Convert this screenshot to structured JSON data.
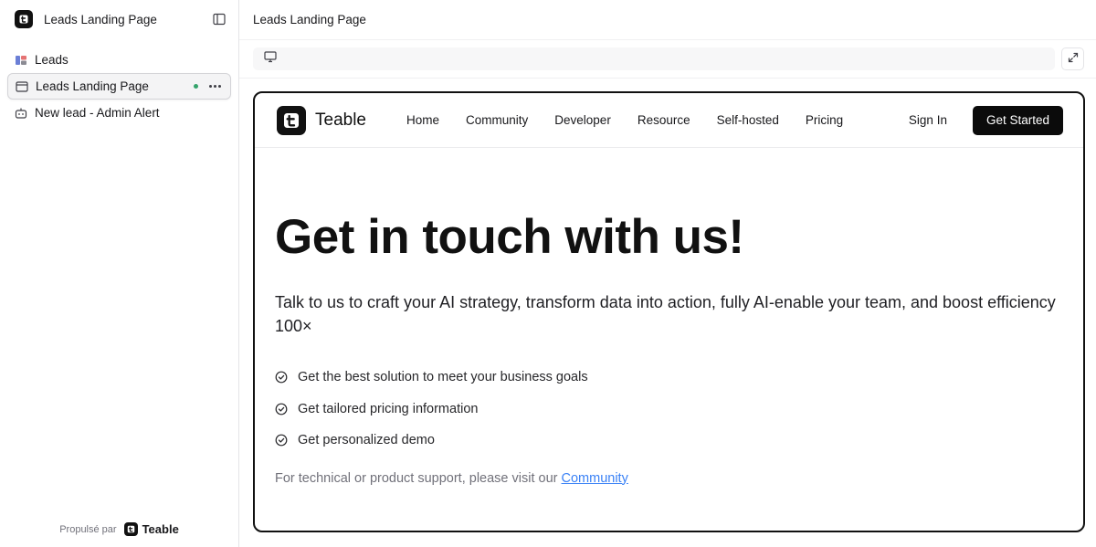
{
  "sidebar": {
    "title": "Leads Landing Page",
    "items": [
      {
        "label": "Leads",
        "icon": "table-icon"
      },
      {
        "label": "Leads Landing Page",
        "icon": "browser-window-icon",
        "active": true
      },
      {
        "label": "New lead - Admin Alert",
        "icon": "bot-icon"
      }
    ],
    "powered_by": "Propulsé par",
    "powered_brand": "Teable"
  },
  "main": {
    "title": "Leads Landing Page"
  },
  "preview": {
    "brand": "Teable",
    "nav": [
      "Home",
      "Community",
      "Developer",
      "Resource",
      "Self-hosted",
      "Pricing"
    ],
    "sign_in": "Sign In",
    "cta": "Get Started",
    "headline": "Get in touch with us!",
    "lead": "Talk to us to craft your AI strategy, transform data into action, fully AI-enable your team, and boost efficiency 100×",
    "checks": [
      "Get the best solution to meet your business goals",
      "Get tailored pricing information",
      "Get personalized demo"
    ],
    "support_text": "For technical or product support, please visit our ",
    "support_link": "Community"
  },
  "colors": {
    "accent_dot": "#34a36b",
    "link": "#3b82f6",
    "cta_bg": "#0b0b0b"
  }
}
